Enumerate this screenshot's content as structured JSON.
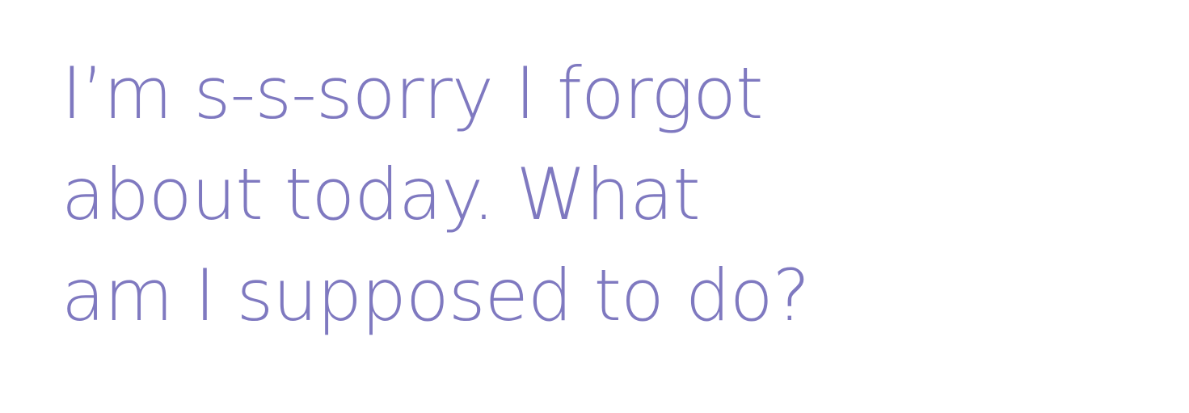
{
  "text_color": "#7f79c0",
  "background_color": "#ffffff",
  "quote": {
    "lines": [
      "I’m s-s-sorry I forgot",
      "about today. What",
      "am I supposed to do?"
    ]
  }
}
